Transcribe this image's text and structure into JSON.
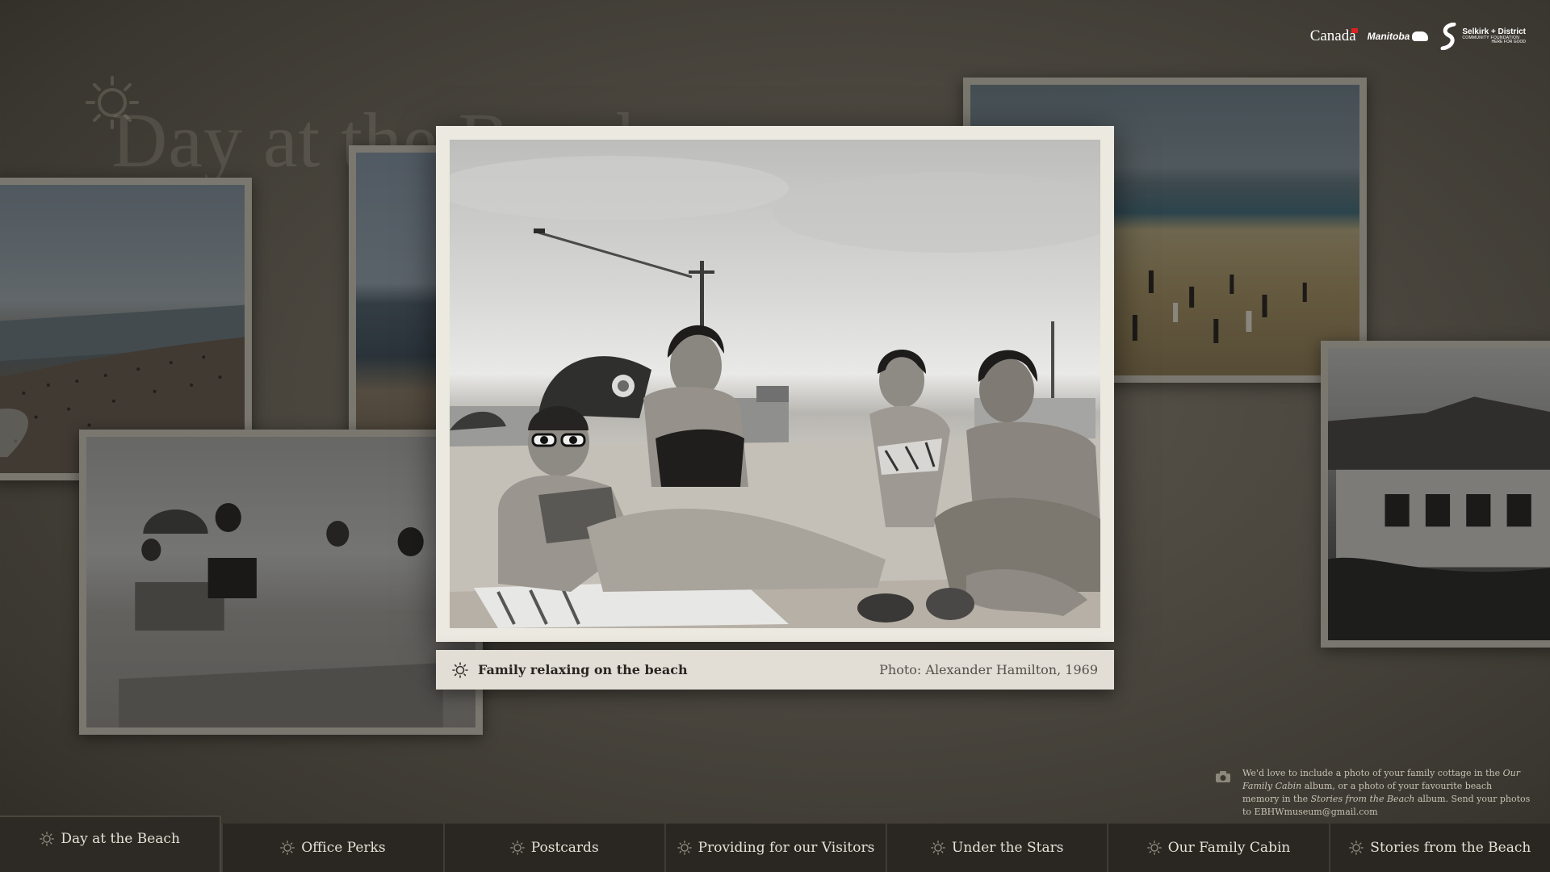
{
  "background": {
    "title": "Day at the Beach",
    "sun_icon": "sun-icon"
  },
  "logos": {
    "canada": "Canada",
    "manitoba": "Manitoba",
    "selkirk_line1": "Selkirk + District",
    "selkirk_line2": "COMMUNITY FOUNDATION",
    "selkirk_line3": "HERE FOR GOOD"
  },
  "featured_photo": {
    "title": "Family relaxing on the beach",
    "credit": "Photo: Alexander Hamilton, 1969"
  },
  "note": {
    "icon": "camera-icon",
    "part1": "We'd love to include a photo of your family cottage in the ",
    "album1": "Our Family Cabin",
    "part2": " album, or a photo of your favourite beach memory in the ",
    "album2": "Stories from the Beach",
    "part3": " album. Send your photos to EBHWmuseum@gmail.com"
  },
  "nav": {
    "items": [
      {
        "label": "Day at the Beach",
        "active": true
      },
      {
        "label": "Office Perks",
        "active": false
      },
      {
        "label": "Postcards",
        "active": false
      },
      {
        "label": "Providing for our Visitors",
        "active": false
      },
      {
        "label": "Under the Stars",
        "active": false
      },
      {
        "label": "Our Family Cabin",
        "active": false
      },
      {
        "label": "Stories from the Beach",
        "active": false
      }
    ]
  },
  "colors": {
    "background": "#4a463e",
    "caption_bg": "#e2ded5",
    "nav_bg": "#2a2722",
    "frame": "#ece9e1"
  }
}
